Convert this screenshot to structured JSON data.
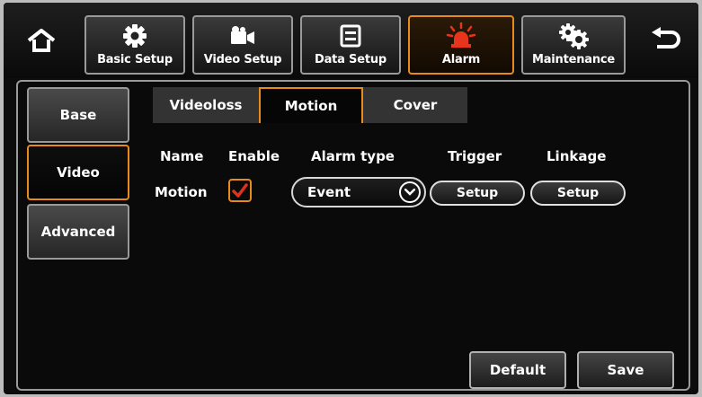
{
  "top_menu": {
    "home_icon": "home-icon",
    "back_icon": "back-arrow-icon",
    "tabs": [
      {
        "label": "Basic Setup",
        "icon": "gear-icon"
      },
      {
        "label": "Video Setup",
        "icon": "video-camera-icon"
      },
      {
        "label": "Data Setup",
        "icon": "storage-icon"
      },
      {
        "label": "Alarm",
        "icon": "alarm-siren-icon",
        "active": true
      },
      {
        "label": "Maintenance",
        "icon": "maintenance-gears-icon"
      }
    ]
  },
  "side_menu": {
    "items": [
      {
        "label": "Base"
      },
      {
        "label": "Video",
        "active": true
      },
      {
        "label": "Advanced"
      }
    ]
  },
  "sub_tabs": [
    {
      "label": "Videoloss"
    },
    {
      "label": "Motion",
      "active": true
    },
    {
      "label": "Cover"
    }
  ],
  "table": {
    "headers": {
      "name": "Name",
      "enable": "Enable",
      "alarm_type": "Alarm type",
      "trigger": "Trigger",
      "linkage": "Linkage"
    },
    "row": {
      "name": "Motion",
      "enabled": true,
      "alarm_type": "Event",
      "trigger_button": "Setup",
      "linkage_button": "Setup"
    }
  },
  "footer": {
    "default_label": "Default",
    "save_label": "Save"
  },
  "colors": {
    "accent": "#e98a1c",
    "alarm_red": "#e8341c",
    "check_red": "#e0301e",
    "background": "#0c0c0c"
  }
}
